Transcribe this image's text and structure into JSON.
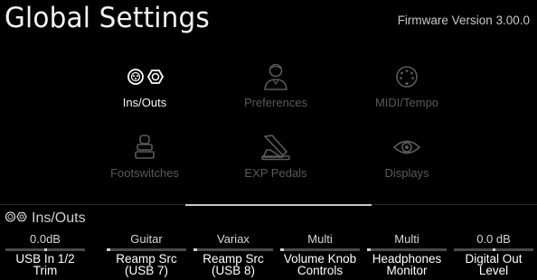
{
  "header": {
    "title": "Global Settings",
    "firmware": "Firmware Version 3.00.0"
  },
  "menu": [
    {
      "label": "Ins/Outs",
      "icon": "ins-outs-icon",
      "active": true
    },
    {
      "label": "Preferences",
      "icon": "user-icon",
      "active": false
    },
    {
      "label": "MIDI/Tempo",
      "icon": "midi-port-icon",
      "active": false
    },
    {
      "label": "Footswitches",
      "icon": "footswitch-icon",
      "active": false
    },
    {
      "label": "EXP Pedals",
      "icon": "expression-pedal-icon",
      "active": false
    },
    {
      "label": "Displays",
      "icon": "eye-icon",
      "active": false
    }
  ],
  "section": {
    "title": "Ins/Outs",
    "icon": "ins-outs-icon"
  },
  "knobs": [
    {
      "value": "0.0dB",
      "line1": "USB In 1/2",
      "line2": "Trim",
      "level": 0.5
    },
    {
      "value": "Guitar",
      "line1": "Reamp Src",
      "line2": "(USB 7)",
      "level": 0.0
    },
    {
      "value": "Variax",
      "line1": "Reamp Src",
      "line2": "(USB 8)",
      "level": 0.0
    },
    {
      "value": "Multi",
      "line1": "Volume Knob",
      "line2": "Controls",
      "level": 0.0
    },
    {
      "value": "Multi",
      "line1": "Headphones",
      "line2": "Monitor",
      "level": 0.0
    },
    {
      "value": "0.0 dB",
      "line1": "Digital Out",
      "line2": "Level",
      "level": 0.5
    }
  ],
  "colors": {
    "background": "#000000",
    "active_text": "#ffffff",
    "inactive_text": "#5a5a5a",
    "bar_track": "#4a4a4a"
  }
}
